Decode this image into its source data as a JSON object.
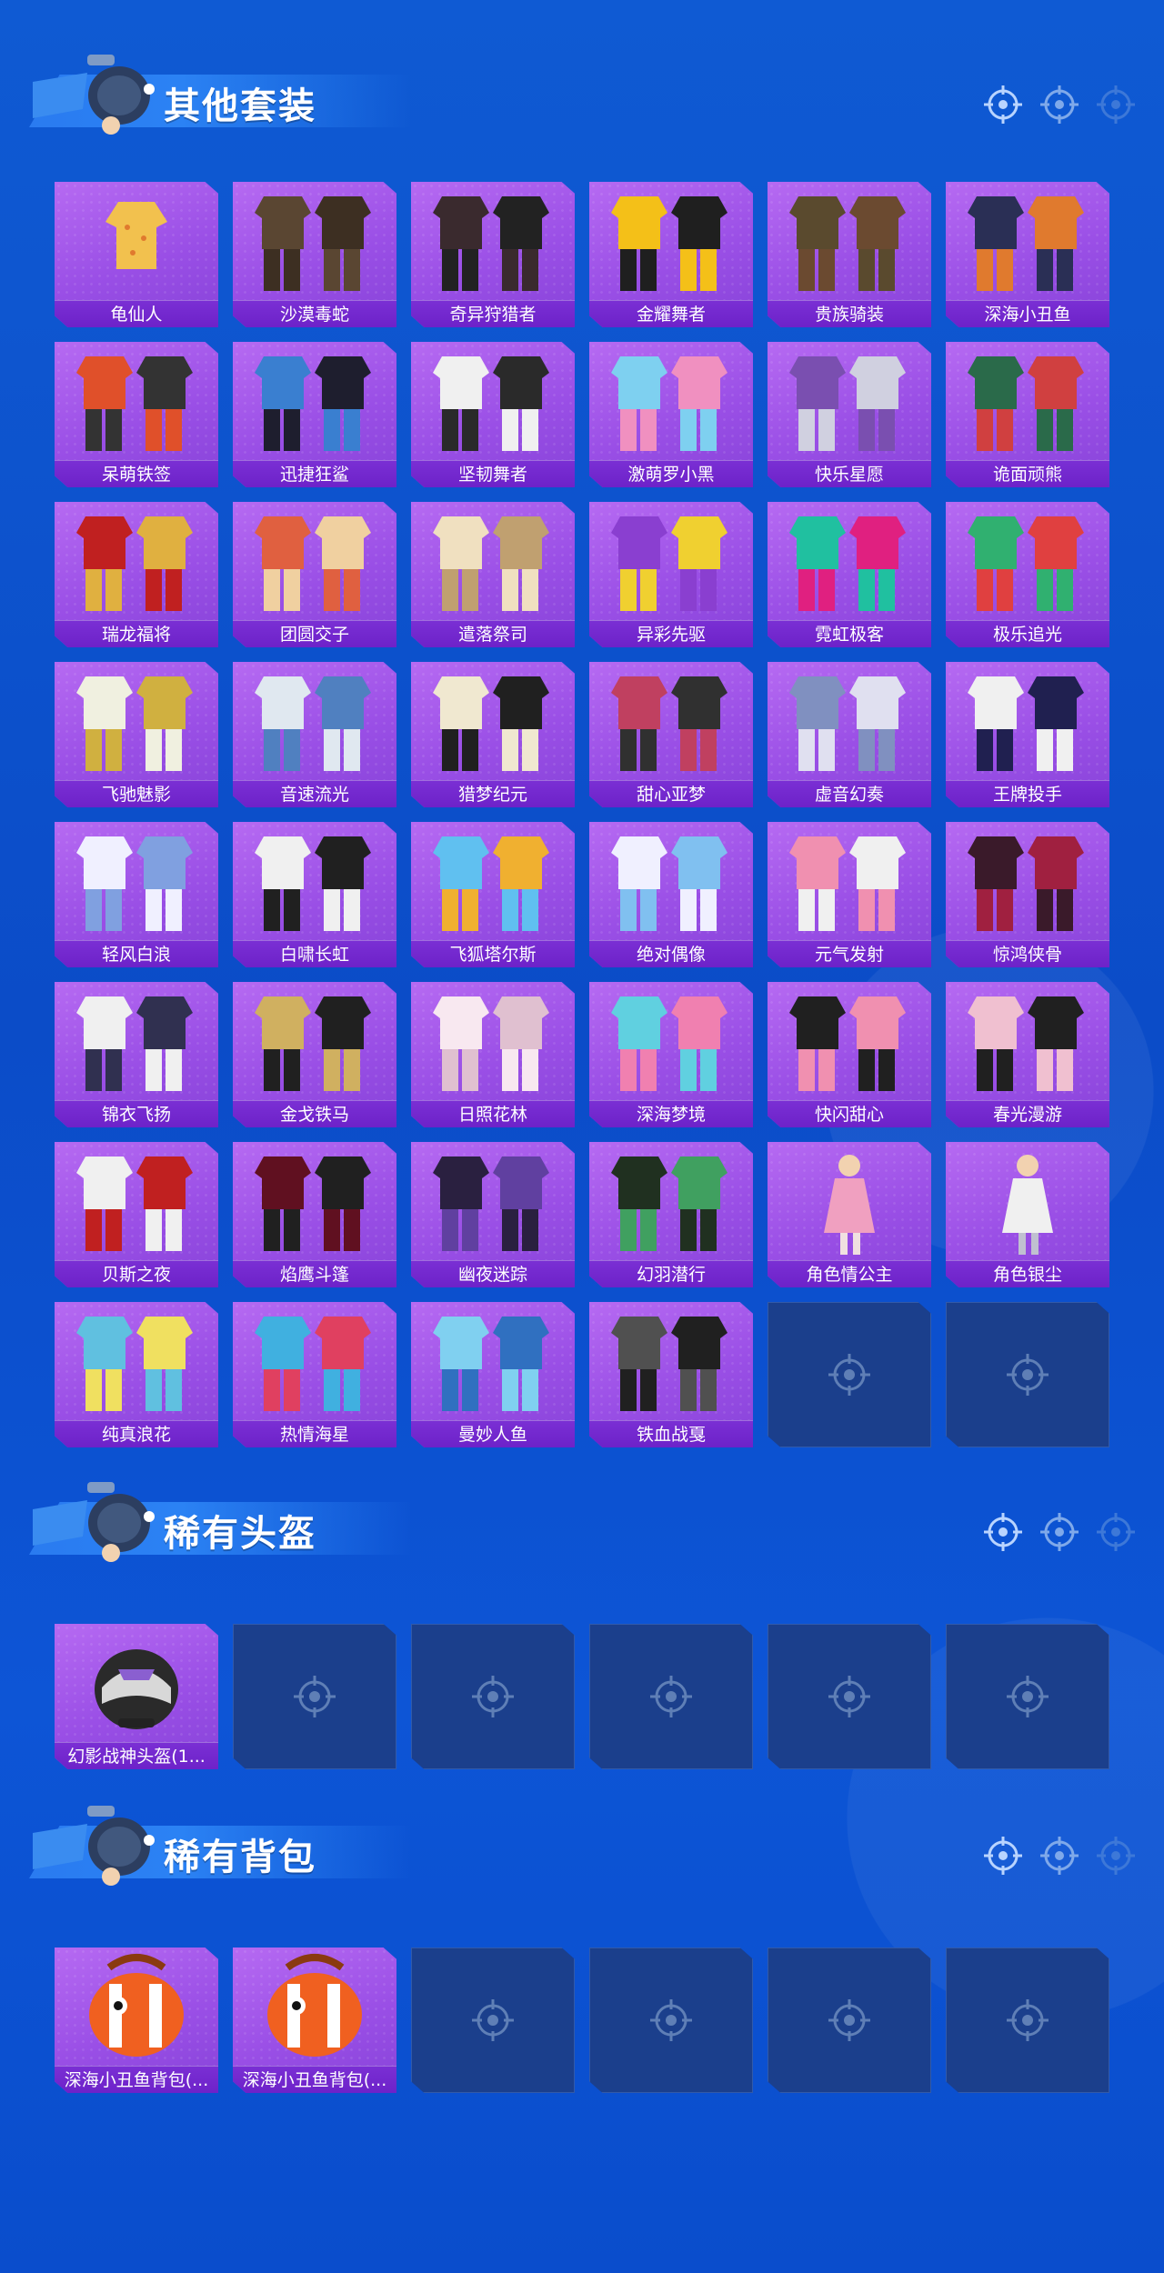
{
  "sections": [
    {
      "title": "其他套装",
      "items": [
        {
          "label": "龟仙人",
          "art": "a",
          "c1": "#f2c14e",
          "c2": "#e07a2e"
        },
        {
          "label": "沙漠毒蛇",
          "art": "b",
          "c1": "#5a4632",
          "c2": "#3d2f22"
        },
        {
          "label": "奇异狩猎者",
          "art": "b",
          "c1": "#3a2a2e",
          "c2": "#222"
        },
        {
          "label": "金耀舞者",
          "art": "b",
          "c1": "#f4c018",
          "c2": "#1f1f1f"
        },
        {
          "label": "贵族骑装",
          "art": "b",
          "c1": "#5a4a2e",
          "c2": "#6b4a30"
        },
        {
          "label": "深海小丑鱼",
          "art": "b",
          "c1": "#2a2f55",
          "c2": "#e07a2e"
        },
        {
          "label": "呆萌铁签",
          "art": "b",
          "c1": "#e0502a",
          "c2": "#333"
        },
        {
          "label": "迅捷狂鲨",
          "art": "b",
          "c1": "#3a7fd0",
          "c2": "#1e1e2e"
        },
        {
          "label": "坚韧舞者",
          "art": "b",
          "c1": "#f0f0f0",
          "c2": "#2a2a2a"
        },
        {
          "label": "激萌罗小黑",
          "art": "b",
          "c1": "#7ed0f0",
          "c2": "#f090c0"
        },
        {
          "label": "快乐星愿",
          "art": "b",
          "c1": "#7a4fb0",
          "c2": "#d0d0e0"
        },
        {
          "label": "诡面顽熊",
          "art": "b",
          "c1": "#2a6a4a",
          "c2": "#d04040"
        },
        {
          "label": "瑞龙福将",
          "art": "b",
          "c1": "#c02020",
          "c2": "#e0b040"
        },
        {
          "label": "团圆交子",
          "art": "b",
          "c1": "#e06040",
          "c2": "#f0d0a0"
        },
        {
          "label": "遣落祭司",
          "art": "b",
          "c1": "#f0e0c0",
          "c2": "#c0a070"
        },
        {
          "label": "异彩先驱",
          "art": "b",
          "c1": "#8a3fd0",
          "c2": "#f0d030"
        },
        {
          "label": "霓虹极客",
          "art": "b",
          "c1": "#20c0a0",
          "c2": "#e02080"
        },
        {
          "label": "极乐追光",
          "art": "b",
          "c1": "#30b070",
          "c2": "#e04040"
        },
        {
          "label": "飞驰魅影",
          "art": "b",
          "c1": "#f0f0e0",
          "c2": "#d0b040"
        },
        {
          "label": "音速流光",
          "art": "b",
          "c1": "#e0e8f0",
          "c2": "#5080c0"
        },
        {
          "label": "猎梦纪元",
          "art": "b",
          "c1": "#f0e8d0",
          "c2": "#202020"
        },
        {
          "label": "甜心亚梦",
          "art": "b",
          "c1": "#c04060",
          "c2": "#303030"
        },
        {
          "label": "虚音幻奏",
          "art": "b",
          "c1": "#8090c0",
          "c2": "#e0e0f0"
        },
        {
          "label": "王牌投手",
          "art": "b",
          "c1": "#f0f0f0",
          "c2": "#202050"
        },
        {
          "label": "轻风白浪",
          "art": "b",
          "c1": "#f0f0ff",
          "c2": "#80a0e0"
        },
        {
          "label": "白啸长虹",
          "art": "b",
          "c1": "#f0f0f0",
          "c2": "#202020"
        },
        {
          "label": "飞狐塔尔斯",
          "art": "b",
          "c1": "#60c0f0",
          "c2": "#f0b030"
        },
        {
          "label": "绝对偶像",
          "art": "b",
          "c1": "#f0f0ff",
          "c2": "#80c0f0"
        },
        {
          "label": "元气发射",
          "art": "b",
          "c1": "#f090b0",
          "c2": "#f0f0f0"
        },
        {
          "label": "惊鸿侠骨",
          "art": "b",
          "c1": "#3a1a2a",
          "c2": "#a02040"
        },
        {
          "label": "锦衣飞扬",
          "art": "b",
          "c1": "#f0f0f0",
          "c2": "#303050"
        },
        {
          "label": "金戈铁马",
          "art": "b",
          "c1": "#d0b060",
          "c2": "#202020"
        },
        {
          "label": "日照花林",
          "art": "b",
          "c1": "#f8e8f0",
          "c2": "#e0c0d0"
        },
        {
          "label": "深海梦境",
          "art": "b",
          "c1": "#60d0e0",
          "c2": "#f080b0"
        },
        {
          "label": "快闪甜心",
          "art": "b",
          "c1": "#202020",
          "c2": "#f090b0"
        },
        {
          "label": "春光漫游",
          "art": "b",
          "c1": "#f0c0d0",
          "c2": "#202020"
        },
        {
          "label": "贝斯之夜",
          "art": "b",
          "c1": "#f0f0f0",
          "c2": "#c02020"
        },
        {
          "label": "焰鹰斗篷",
          "art": "b",
          "c1": "#601020",
          "c2": "#202020"
        },
        {
          "label": "幽夜迷踪",
          "art": "b",
          "c1": "#2a2040",
          "c2": "#6040a0"
        },
        {
          "label": "幻羽潜行",
          "art": "b",
          "c1": "#203020",
          "c2": "#40a060"
        },
        {
          "label": "角色情公主",
          "art": "c",
          "c1": "#f0a0c0",
          "c2": "#f0e0e0"
        },
        {
          "label": "角色银尘",
          "art": "c",
          "c1": "#f0f0f0",
          "c2": "#c0c0d0"
        },
        {
          "label": "纯真浪花",
          "art": "b",
          "c1": "#60c0e0",
          "c2": "#f0e060"
        },
        {
          "label": "热情海星",
          "art": "b",
          "c1": "#40b0e0",
          "c2": "#e04060"
        },
        {
          "label": "曼妙人鱼",
          "art": "b",
          "c1": "#80d0f0",
          "c2": "#3070c0"
        },
        {
          "label": "铁血战戛",
          "art": "b",
          "c1": "#505050",
          "c2": "#202020"
        }
      ],
      "empty_slots": 2
    },
    {
      "title": "稀有头盔",
      "items": [
        {
          "label": "幻影战神头盔(1...",
          "art": "helmet",
          "c1": "#2a2a2a",
          "c2": "#8a5fd0"
        }
      ],
      "empty_slots": 5
    },
    {
      "title": "稀有背包",
      "items": [
        {
          "label": "深海小丑鱼背包(...",
          "art": "bag",
          "c1": "#f06020",
          "c2": "#ffffff"
        },
        {
          "label": "深海小丑鱼背包(...",
          "art": "bag",
          "c1": "#f06020",
          "c2": "#ffffff"
        }
      ],
      "empty_slots": 4
    }
  ],
  "colors": {
    "card_bg": "#9a4fe6",
    "card_label_bg": "#7a2fd4",
    "empty_slot_bg": "#1b3f8c",
    "page_bg": "#0f5ad3"
  },
  "icons": {
    "header_target": "crosshair-icon",
    "empty_slot": "crosshair-icon",
    "mascot": "mascot-figure"
  }
}
